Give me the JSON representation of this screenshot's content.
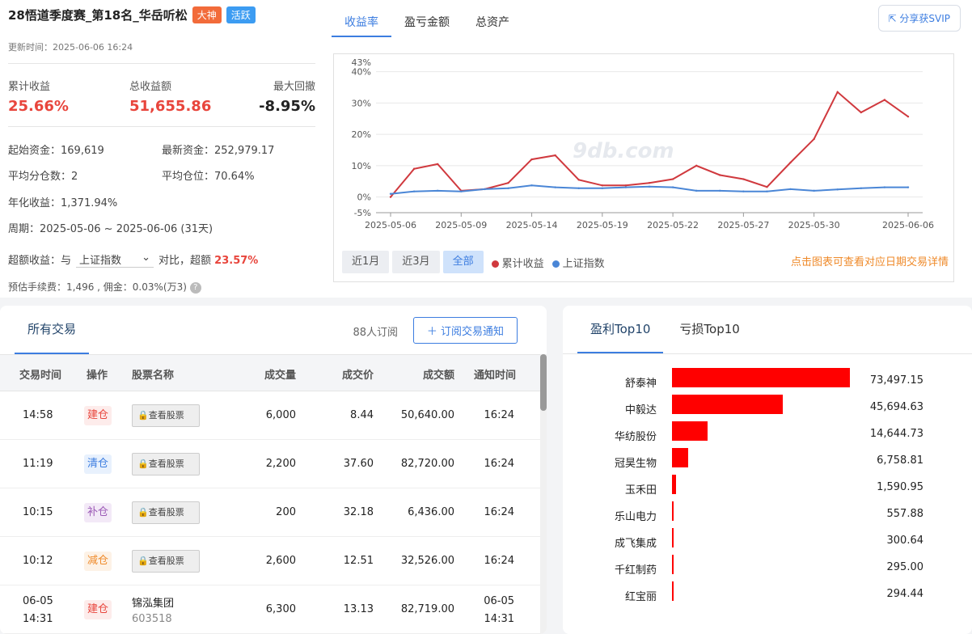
{
  "header": {
    "title": "28悟道季度赛_第18名_华岳听松",
    "badge1": "大神",
    "badge2": "活跃",
    "update_time": "更新时间：2025-06-06 16:24"
  },
  "kpis": [
    {
      "label": "累计收益",
      "value": "25.66%"
    },
    {
      "label": "总收益额",
      "value": "51,655.86"
    },
    {
      "label": "最大回撤",
      "value": "-8.95%"
    }
  ],
  "info": {
    "start_capital": "起始资金：169,619",
    "latest_capital": "最新资金：252,979.17",
    "avg_positions": "平均分仓数：2",
    "avg_position_ratio": "平均仓位：70.64%",
    "annual_return": "年化收益：1,371.94%",
    "period": "周期：2025-05-06 ~ 2025-06-06 (31天)",
    "excess_prefix": "超额收益：与",
    "excess_select": "上证指数",
    "excess_mid": "对比，超额",
    "excess_value": "23.57%",
    "fee": "预估手续费：1,496 , 佣金：0.03%(万3)",
    "help": "?"
  },
  "chart_tabs": [
    "收益率",
    "盈亏金额",
    "总资产"
  ],
  "share_label": "分享获SVIP",
  "range_buttons": [
    "近1月",
    "近3月",
    "全部"
  ],
  "legend": [
    "累计收益",
    "上证指数"
  ],
  "chart_hint": "点击图表可查看对应日期交易详情",
  "watermark": "9db.com",
  "chart_data": {
    "type": "line",
    "x": [
      "2025-05-06",
      "2025-05-07",
      "2025-05-08",
      "2025-05-09",
      "2025-05-12",
      "2025-05-13",
      "2025-05-14",
      "2025-05-15",
      "2025-05-16",
      "2025-05-19",
      "2025-05-20",
      "2025-05-21",
      "2025-05-22",
      "2025-05-23",
      "2025-05-26",
      "2025-05-27",
      "2025-05-28",
      "2025-05-29",
      "2025-05-30",
      "2025-06-03",
      "2025-06-04",
      "2025-06-05",
      "2025-06-06"
    ],
    "x_tick_labels": [
      "2025-05-06",
      "2025-05-09",
      "2025-05-14",
      "2025-05-19",
      "2025-05-22",
      "2025-05-27",
      "2025-05-30",
      "2025-06-06"
    ],
    "y_tick_labels": [
      "-5%",
      "0%",
      "10%",
      "20%",
      "30%",
      "40%",
      "43%"
    ],
    "ylim": [
      -5,
      43
    ],
    "series": [
      {
        "name": "累计收益",
        "color": "#d0393e",
        "values": [
          0,
          9,
          10.5,
          2,
          2.5,
          4.5,
          12,
          13.3,
          5.5,
          3.7,
          3.7,
          4.5,
          5.7,
          10,
          7,
          5.7,
          3.2,
          11,
          18.5,
          33.5,
          27,
          31,
          25.66
        ]
      },
      {
        "name": "上证指数",
        "color": "#4a86d6",
        "values": [
          1,
          1.8,
          2,
          1.8,
          2.5,
          2.8,
          3.7,
          3.1,
          2.8,
          2.8,
          3.1,
          3.3,
          3.1,
          2,
          2,
          1.8,
          1.8,
          2.5,
          2,
          2.4,
          2.8,
          3.1,
          3.1
        ]
      }
    ]
  },
  "trades": {
    "tab_all": "所有交易",
    "subscribers": "88人订阅",
    "subscribe_btn": "＋ 订阅交易通知",
    "headers": [
      "交易时间",
      "操作",
      "股票名称",
      "成交量",
      "成交价",
      "成交额",
      "通知时间"
    ],
    "look_label": "查看股票",
    "rows": [
      {
        "time": "14:58",
        "op": "建仓",
        "qty": "6,000",
        "price": "8.44",
        "amount": "50,640.00",
        "notify": "16:24"
      },
      {
        "time": "11:19",
        "op": "清仓",
        "qty": "2,200",
        "price": "37.60",
        "amount": "82,720.00",
        "notify": "16:24"
      },
      {
        "time": "10:15",
        "op": "补仓",
        "qty": "200",
        "price": "32.18",
        "amount": "6,436.00",
        "notify": "16:24"
      },
      {
        "time": "10:12",
        "op": "减仓",
        "qty": "2,600",
        "price": "12.51",
        "amount": "32,526.00",
        "notify": "16:24"
      },
      {
        "time_date": "06-05",
        "time": "14:31",
        "op": "建仓",
        "stock_name": "锦泓集团",
        "stock_code": "603518",
        "qty": "6,300",
        "price": "13.13",
        "amount": "82,719.00",
        "notify_date": "06-05",
        "notify": "14:31"
      }
    ]
  },
  "top10": {
    "tab_profit": "盈利Top10",
    "tab_loss": "亏损Top10",
    "items": [
      {
        "name": "舒泰神",
        "value": "73,497.15",
        "amount": 73497.15
      },
      {
        "name": "中毅达",
        "value": "45,694.63",
        "amount": 45694.63
      },
      {
        "name": "华纺股份",
        "value": "14,644.73",
        "amount": 14644.73
      },
      {
        "name": "冠昊生物",
        "value": "6,758.81",
        "amount": 6758.81
      },
      {
        "name": "玉禾田",
        "value": "1,590.95",
        "amount": 1590.95
      },
      {
        "name": "乐山电力",
        "value": "557.88",
        "amount": 557.88
      },
      {
        "name": "成飞集成",
        "value": "300.64",
        "amount": 300.64
      },
      {
        "name": "千红制药",
        "value": "295.00",
        "amount": 295.0
      },
      {
        "name": "红宝丽",
        "value": "294.44",
        "amount": 294.44
      }
    ]
  }
}
